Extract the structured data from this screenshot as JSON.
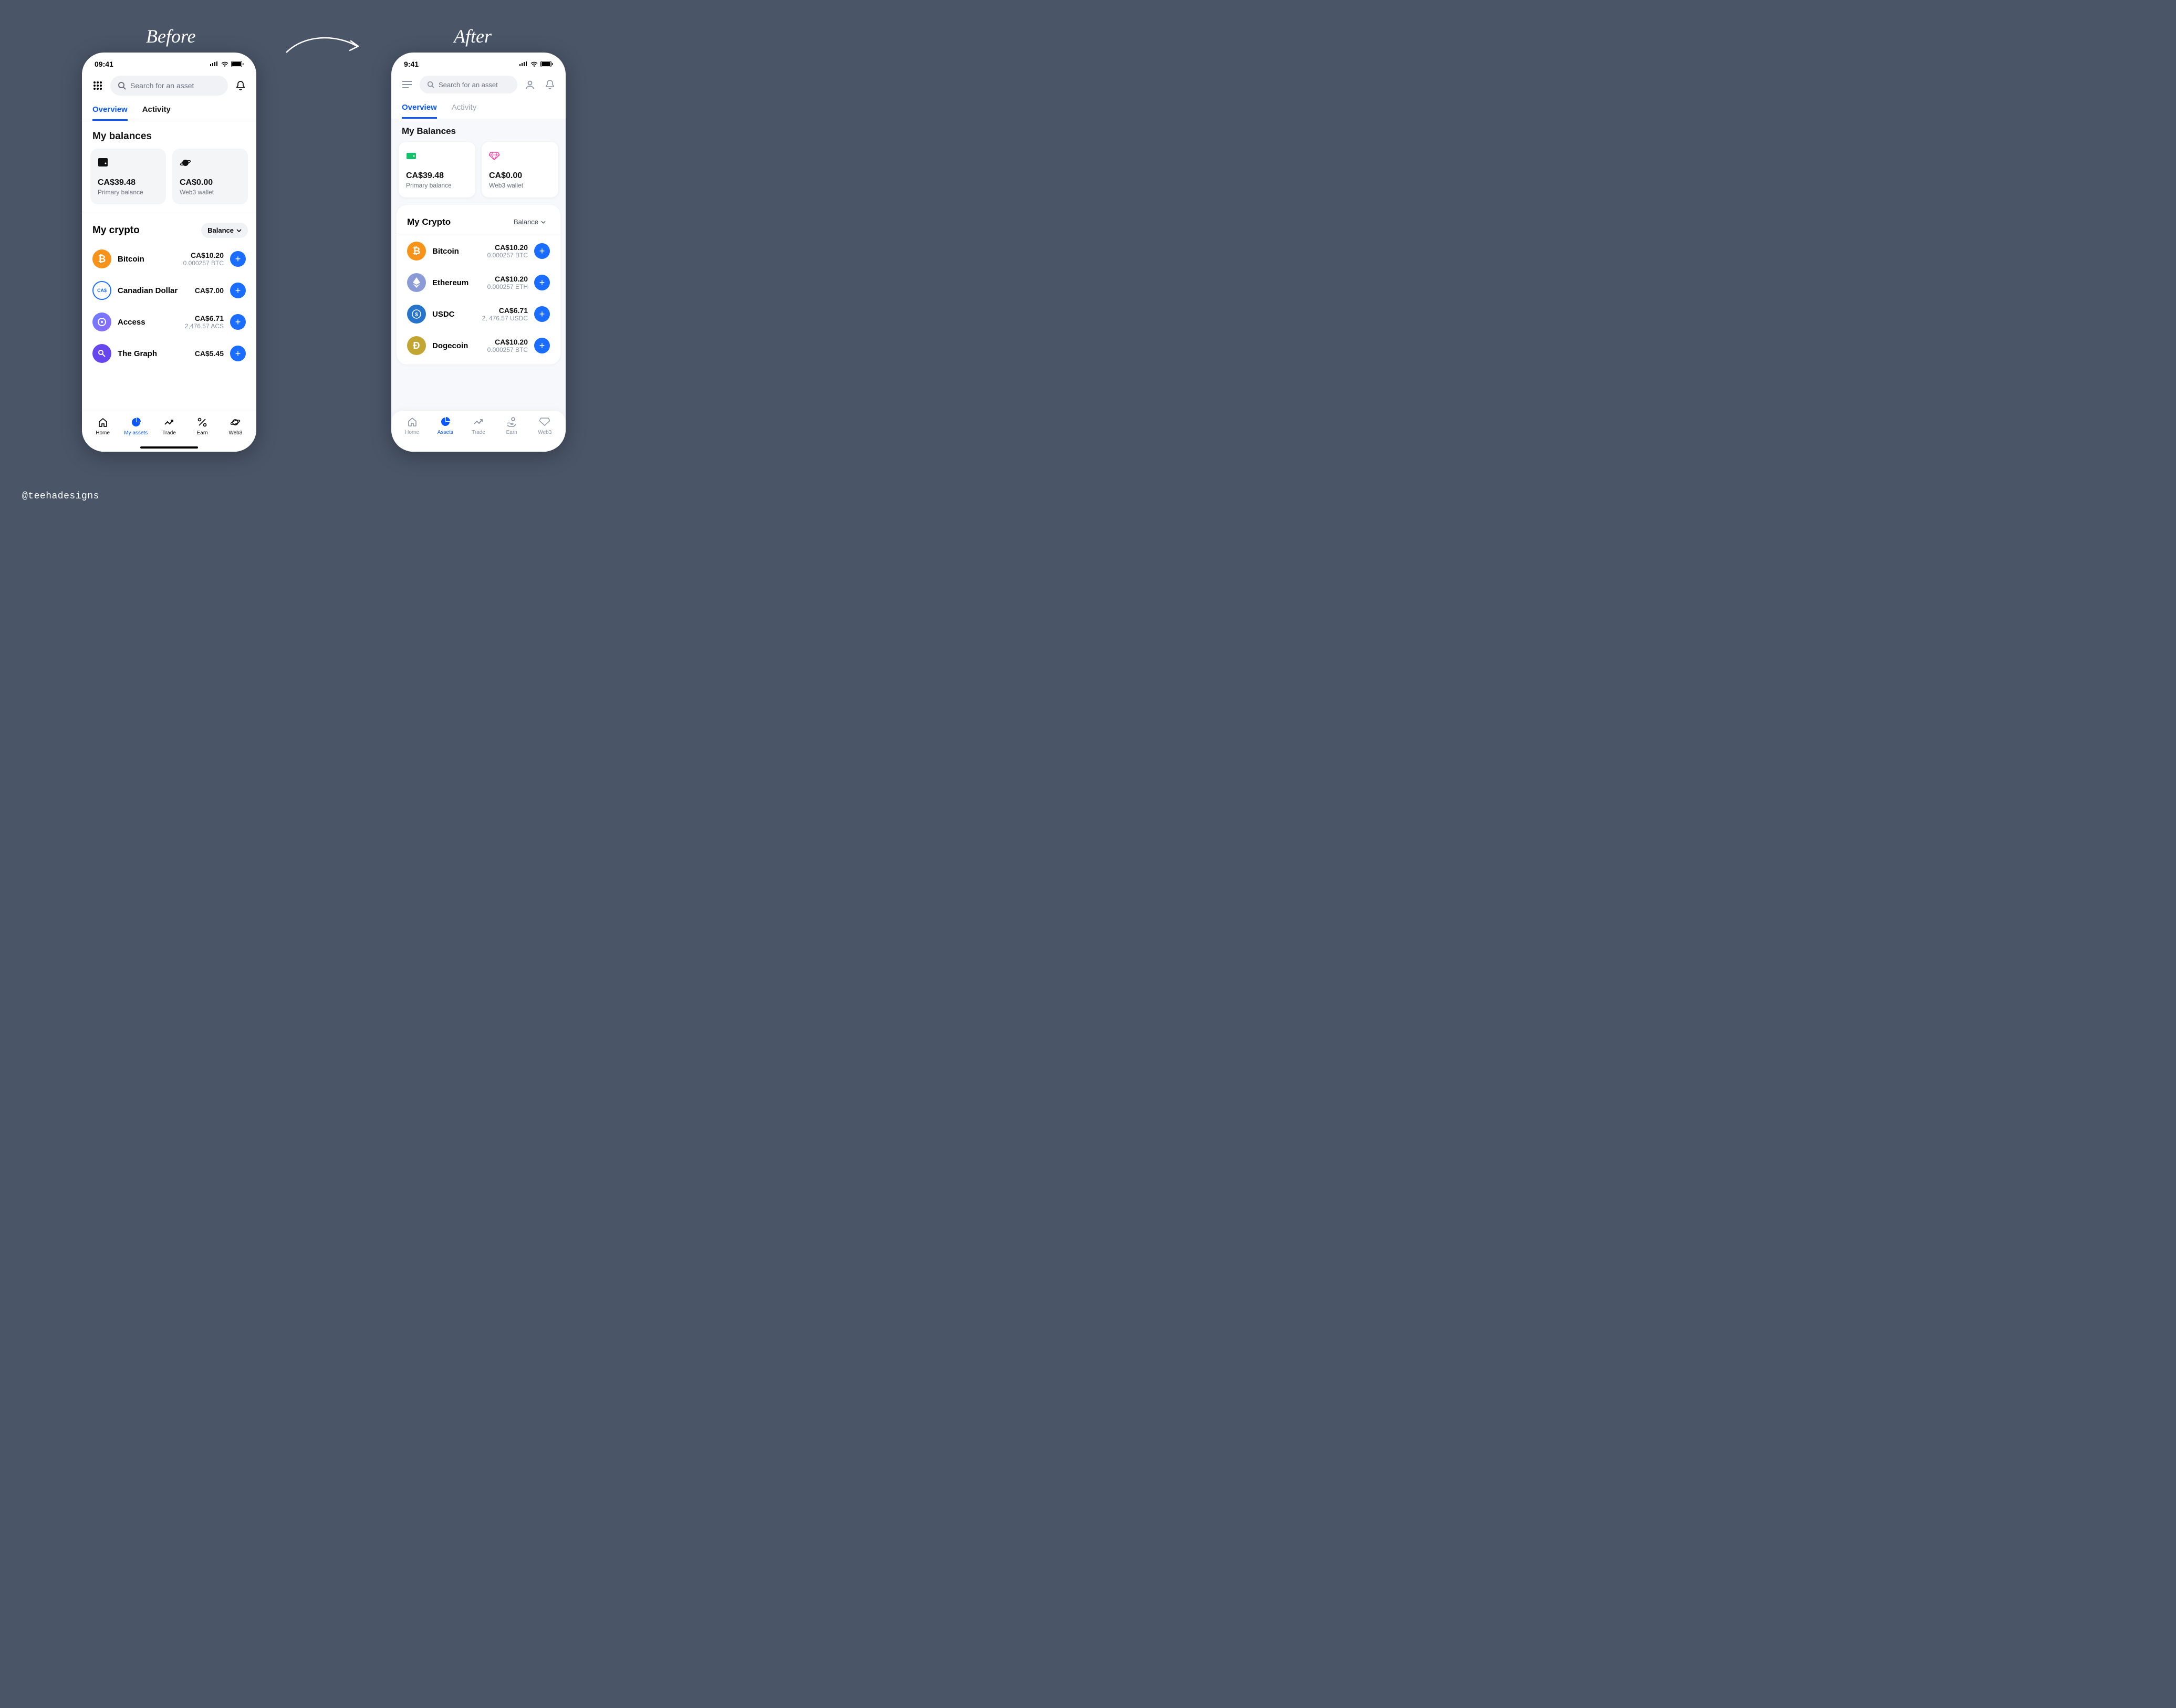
{
  "labels": {
    "before": "Before",
    "after": "After",
    "credit": "@teehadesigns"
  },
  "before": {
    "time": "09:41",
    "search_placeholder": "Search for an asset",
    "tabs": {
      "overview": "Overview",
      "activity": "Activity"
    },
    "balances_title": "My balances",
    "balances": [
      {
        "amount": "CA$39.48",
        "label": "Primary balance"
      },
      {
        "amount": "CA$0.00",
        "label": "Web3 wallet"
      }
    ],
    "crypto_title": "My crypto",
    "balance_dd": "Balance",
    "assets": [
      {
        "name": "Bitcoin",
        "fiat": "CA$10.20",
        "sub": "0.000257 BTC",
        "icon": "btc"
      },
      {
        "name": "Canadian Dollar",
        "fiat": "CA$7.00",
        "sub": "",
        "icon": "cad"
      },
      {
        "name": "Access",
        "fiat": "CA$6.71",
        "sub": "2,476.57 ACS",
        "icon": "acs"
      },
      {
        "name": "The Graph",
        "fiat": "CA$5.45",
        "sub": "",
        "icon": "grt"
      }
    ],
    "nav": {
      "home": "Home",
      "assets": "My assets",
      "trade": "Trade",
      "earn": "Earn",
      "web3": "Web3"
    }
  },
  "after": {
    "time": "9:41",
    "search_placeholder": "Search for an asset",
    "tabs": {
      "overview": "Overview",
      "activity": "Activity"
    },
    "balances_title": "My Balances",
    "balances": [
      {
        "amount": "CA$39.48",
        "label": "Primary balance"
      },
      {
        "amount": "CA$0.00",
        "label": "Web3 wallet"
      }
    ],
    "crypto_title": "My Crypto",
    "balance_dd": "Balance",
    "assets": [
      {
        "name": "Bitcoin",
        "fiat": "CA$10.20",
        "sub": "0.000257 BTC",
        "icon": "btc"
      },
      {
        "name": "Ethereum",
        "fiat": "CA$10.20",
        "sub": "0.000257 ETH",
        "icon": "eth"
      },
      {
        "name": "USDC",
        "fiat": "CA$6.71",
        "sub": "2, 476.57 USDC",
        "icon": "usdc"
      },
      {
        "name": "Dogecoin",
        "fiat": "CA$10.20",
        "sub": "0.000257 BTC",
        "icon": "doge"
      }
    ],
    "nav": {
      "home": "Home",
      "assets": "Assets",
      "trade": "Trade",
      "earn": "Earn",
      "web3": "Web3"
    }
  }
}
